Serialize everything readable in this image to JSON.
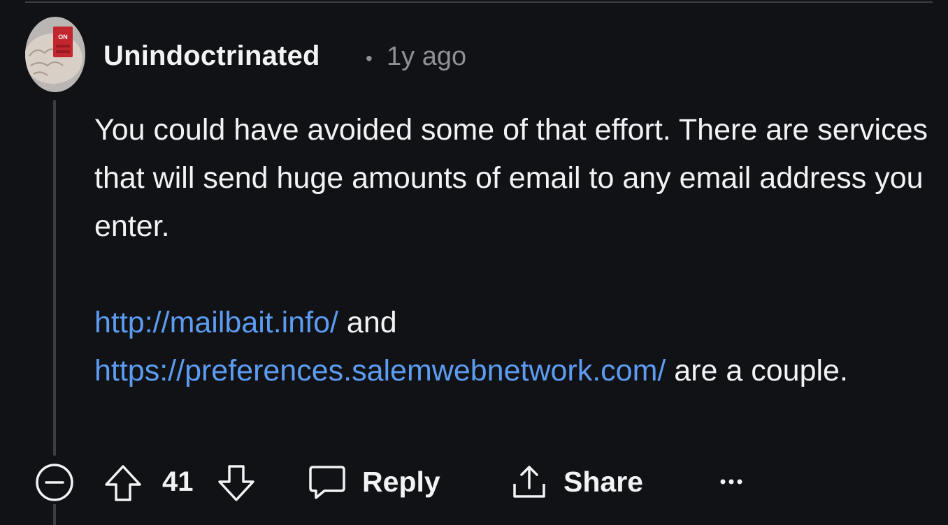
{
  "comment": {
    "username": "Unindoctrinated",
    "separator": "•",
    "timestamp": "1y ago",
    "avatar_icon": "brain-avatar-icon",
    "paragraph1": "You could have avoided some of that effort. There are services that will send huge amounts of email to any email address you enter.",
    "link1": "http://mailbait.info/",
    "text_and": " and ",
    "link2": "https://preferences.salemwebnetwork.com/",
    "text_end": " are a couple."
  },
  "actions": {
    "vote_count": "41",
    "reply_label": "Reply",
    "share_label": "Share"
  },
  "colors": {
    "background": "#111215",
    "link": "#5c9cf2",
    "text": "#f2f3f5",
    "meta": "#8e9297"
  }
}
